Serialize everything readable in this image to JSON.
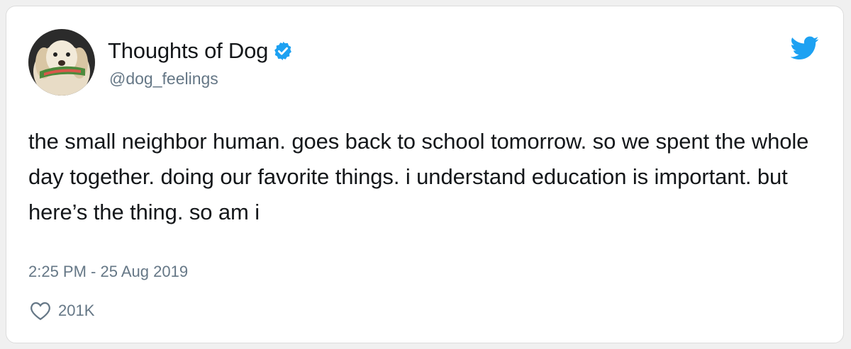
{
  "tweet": {
    "author": {
      "display_name": "Thoughts of Dog",
      "handle": "@dog_feelings",
      "verified": true,
      "avatar_icon": "dog-avatar"
    },
    "text": "the small neighbor human. goes back to school tomorrow. so we spent the whole day together. doing our favorite things. i understand education is important. but here’s the thing. so am i",
    "timestamp": "2:25 PM - 25 Aug 2019",
    "likes": "201K",
    "icons": {
      "brand": "twitter-bird-icon",
      "verified": "verified-badge-icon",
      "like": "heart-icon"
    },
    "colors": {
      "brand_blue": "#1da1f2",
      "text": "#14171a",
      "secondary": "#657786"
    }
  }
}
